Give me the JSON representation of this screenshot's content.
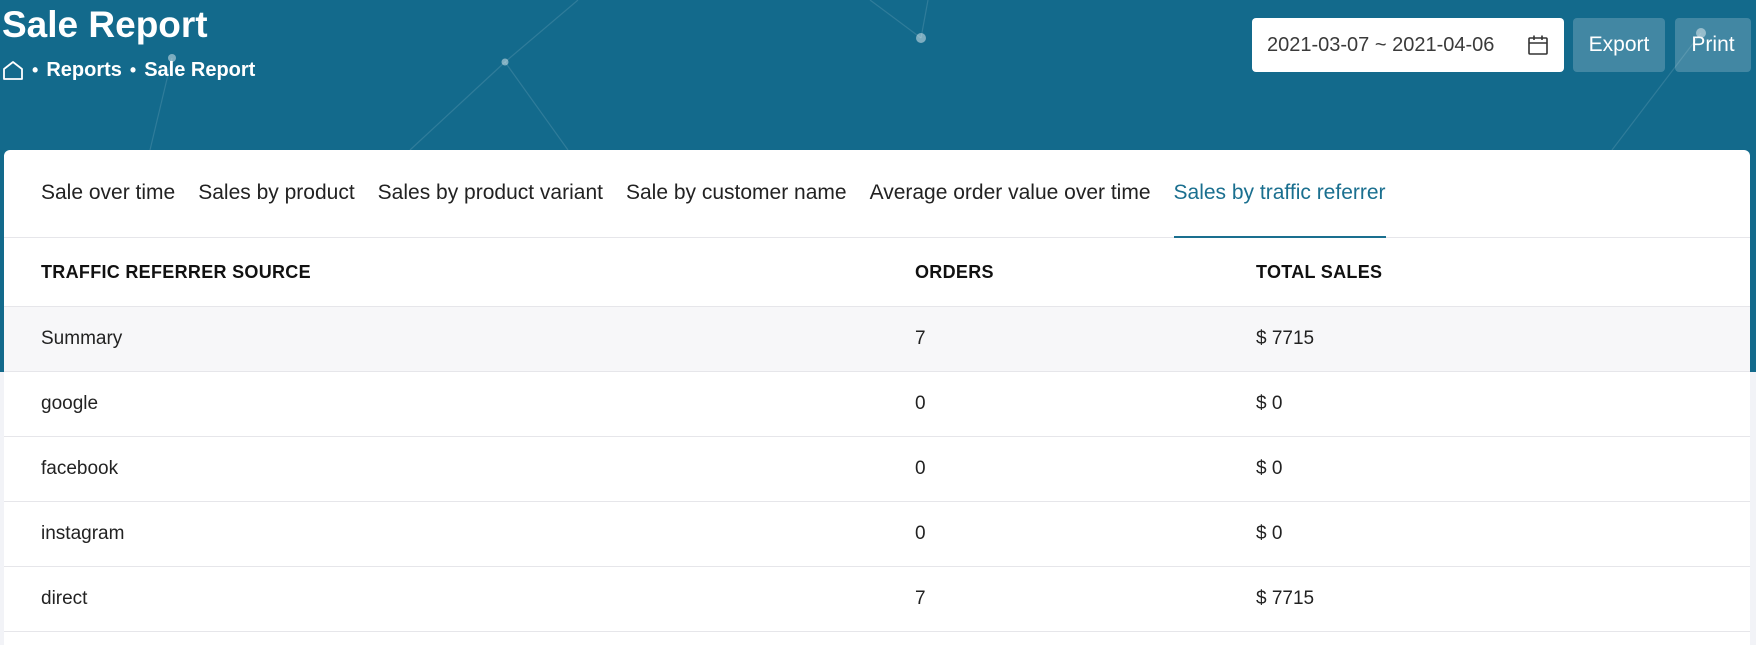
{
  "header": {
    "title": "Sale Report",
    "breadcrumb": {
      "home_icon": "home-icon",
      "separator": "•",
      "items": [
        "Reports",
        "Sale Report"
      ]
    },
    "date_range": {
      "value": "2021-03-07 ~ 2021-04-06",
      "icon": "calendar-icon"
    },
    "export_label": "Export",
    "print_label": "Print"
  },
  "tabs": [
    {
      "label": "Sale over time",
      "active": false
    },
    {
      "label": "Sales by product",
      "active": false
    },
    {
      "label": "Sales by product variant",
      "active": false
    },
    {
      "label": "Sale by customer name",
      "active": false
    },
    {
      "label": "Average order value over time",
      "active": false
    },
    {
      "label": "Sales by traffic referrer",
      "active": true
    }
  ],
  "table": {
    "columns": [
      "TRAFFIC REFERRER SOURCE",
      "ORDERS",
      "TOTAL SALES"
    ],
    "summary": {
      "source": "Summary",
      "orders": "7",
      "total": "$ 7715"
    },
    "rows": [
      {
        "source": "google",
        "orders": "0",
        "total": "$ 0"
      },
      {
        "source": "facebook",
        "orders": "0",
        "total": "$ 0"
      },
      {
        "source": "instagram",
        "orders": "0",
        "total": "$ 0"
      },
      {
        "source": "direct",
        "orders": "7",
        "total": "$ 7715"
      }
    ]
  },
  "colors": {
    "header_background": "#136a8c",
    "accent": "#1a6f8f",
    "button_background": "rgba(255,255,255,0.2)"
  }
}
